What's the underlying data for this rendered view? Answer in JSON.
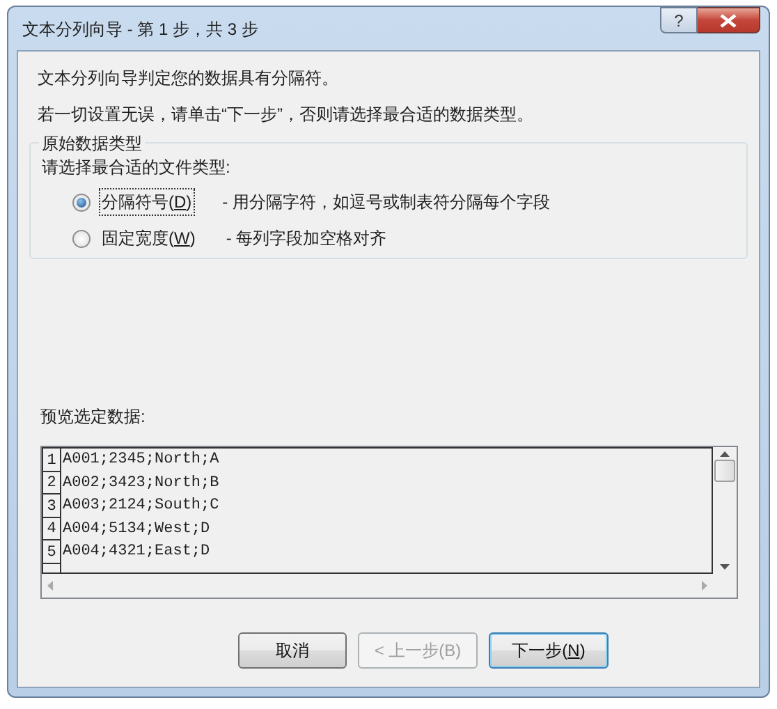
{
  "window": {
    "title": "文本分列向导 - 第 1 步，共 3 步",
    "help_button": "?"
  },
  "intro": [
    "文本分列向导判定您的数据具有分隔符。",
    "若一切设置无误，请单击“下一步”，否则请选择最合适的数据类型。"
  ],
  "group": {
    "legend": "原始数据类型",
    "prompt": "请选择最合适的文件类型:",
    "options": [
      {
        "label_parts": [
          "分隔符号(",
          "D",
          ")"
        ],
        "description": "- 用分隔字符，如逗号或制表符分隔每个字段",
        "selected": true,
        "focused": true
      },
      {
        "label_parts": [
          "固定宽度(",
          "W",
          ")"
        ],
        "description": "- 每列字段加空格对齐",
        "selected": false,
        "focused": false
      }
    ]
  },
  "preview": {
    "label": "预览选定数据:",
    "rows": [
      {
        "number": "1",
        "text": "A001;2345;North;A"
      },
      {
        "number": "2",
        "text": "A002;3423;North;B"
      },
      {
        "number": "3",
        "text": "A003;2124;South;C"
      },
      {
        "number": "4",
        "text": "A004;5134;West;D"
      },
      {
        "number": "5",
        "text": "A004;4321;East;D"
      }
    ]
  },
  "buttons": [
    {
      "label_parts": [
        "取消"
      ],
      "disabled": false,
      "default": false
    },
    {
      "label_parts": [
        "< 上一步(B)"
      ],
      "disabled": true,
      "default": false
    },
    {
      "label_parts": [
        "下一步(",
        "N",
        ")"
      ],
      "disabled": false,
      "default": true
    }
  ]
}
